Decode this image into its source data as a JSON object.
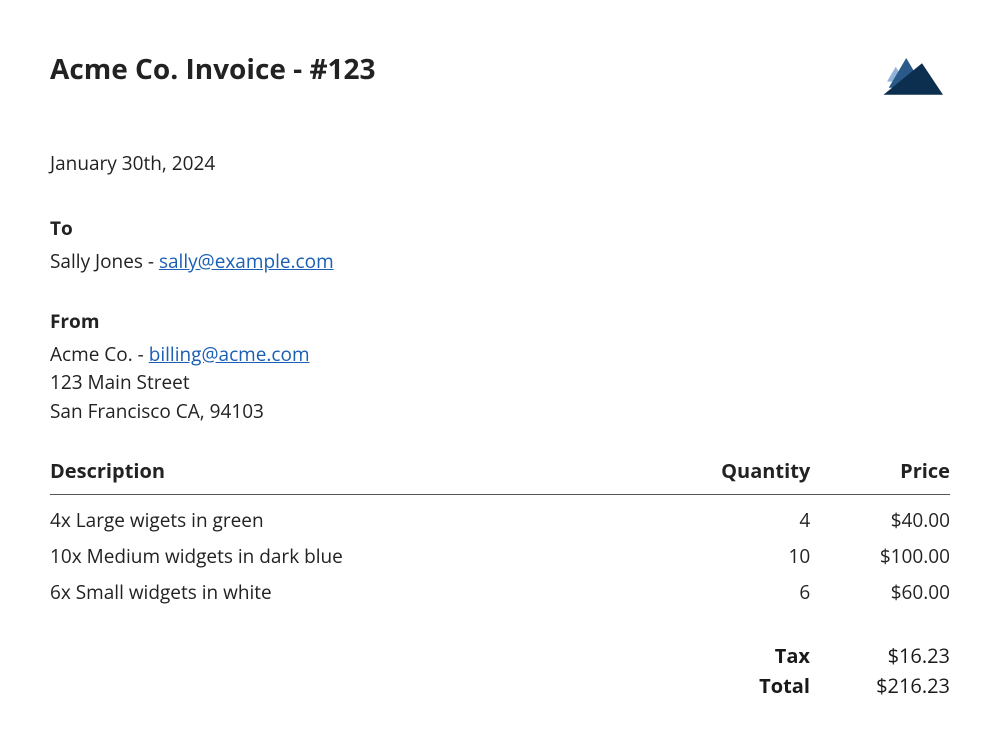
{
  "title": "Acme Co. Invoice - #123",
  "date": "January 30th, 2024",
  "to": {
    "label": "To",
    "name": "Sally Jones",
    "separator": " - ",
    "email": "sally@example.com"
  },
  "from": {
    "label": "From",
    "name": "Acme Co.",
    "separator": " - ",
    "email": "billing@acme.com",
    "address_line1": "123 Main Street",
    "address_line2": "San Francisco CA, 94103"
  },
  "table": {
    "headers": {
      "description": "Description",
      "quantity": "Quantity",
      "price": "Price"
    },
    "rows": [
      {
        "description": "4x Large wigets in green",
        "quantity": "4",
        "price": "$40.00"
      },
      {
        "description": "10x Medium widgets in dark blue",
        "quantity": "10",
        "price": "$100.00"
      },
      {
        "description": "6x Small widgets in white",
        "quantity": "6",
        "price": "$60.00"
      }
    ]
  },
  "summary": {
    "tax_label": "Tax",
    "tax_value": "$16.23",
    "total_label": "Total",
    "total_value": "$216.23"
  }
}
